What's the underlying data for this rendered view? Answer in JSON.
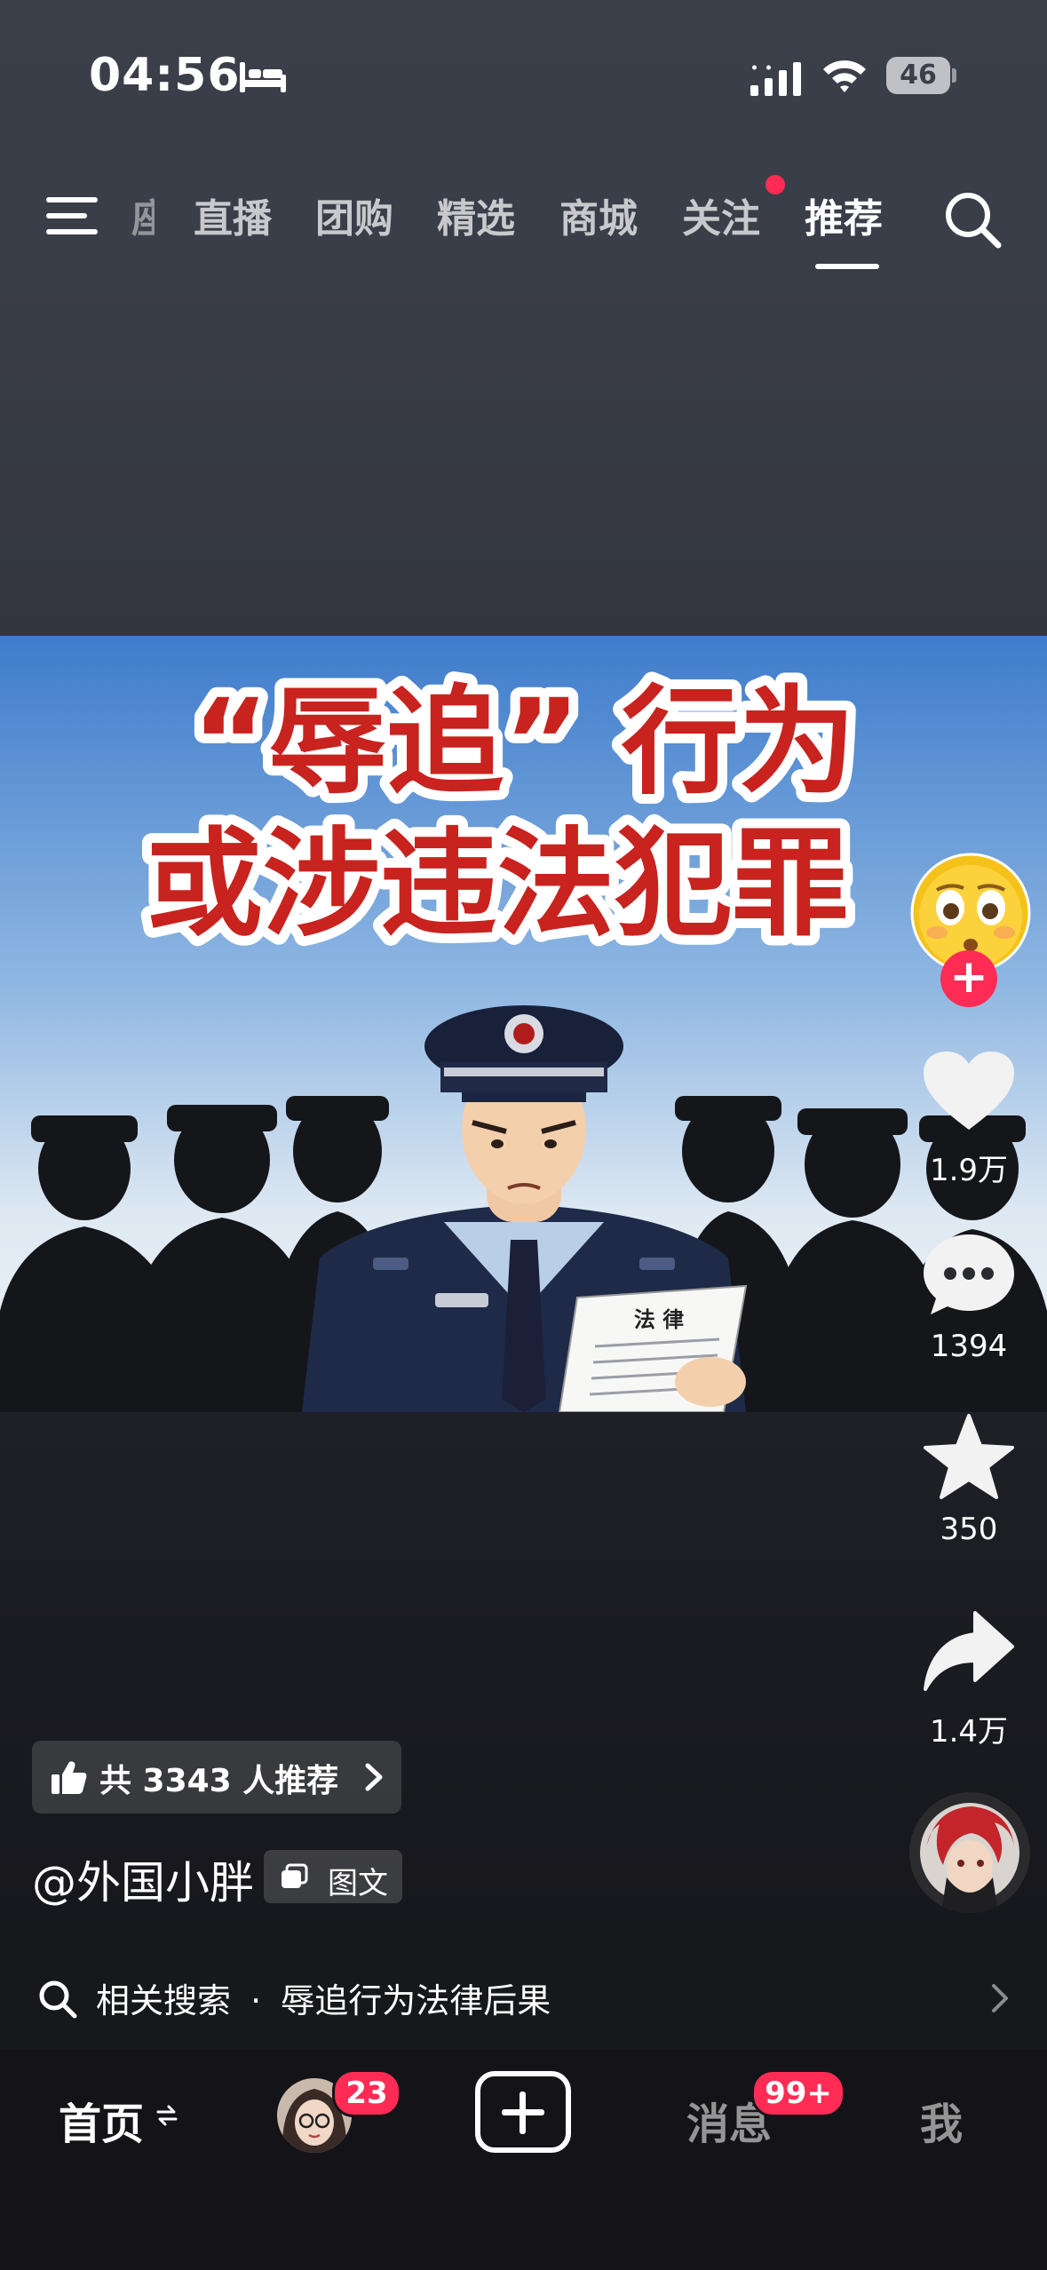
{
  "status_bar": {
    "time": "04:56",
    "battery": "46"
  },
  "top_nav": {
    "tabs": [
      {
        "label": "座",
        "state": "partial"
      },
      {
        "label": "直播"
      },
      {
        "label": "团购"
      },
      {
        "label": "精选"
      },
      {
        "label": "商城"
      },
      {
        "label": "关注",
        "has_dot": true
      },
      {
        "label": "推荐",
        "active": true
      }
    ]
  },
  "post": {
    "headline_line1": "“辱追” 行为",
    "headline_line2": "或涉违法犯罪",
    "document_title": "法 律",
    "author": "@外国小胖",
    "type_badge": "图文",
    "recommend_text": "共 3343 人推荐"
  },
  "actions": {
    "likes": "1.9万",
    "comments": "1394",
    "favorites": "350",
    "shares": "1.4万"
  },
  "related_search": {
    "prefix": "相关搜索",
    "separator": "·",
    "query": "辱追行为法律后果"
  },
  "bottom_tabs": {
    "home": "首页",
    "friends_badge": "23",
    "messages": "消息",
    "messages_badge": "99+",
    "me": "我"
  },
  "colors": {
    "accent": "#fe2c55",
    "headline_red": "#c8231e",
    "sky_top": "#3f7ccc",
    "uniform": "#1e2a48"
  },
  "icons": [
    "bed-icon",
    "signal-icon",
    "wifi-icon",
    "menu-icon",
    "search-icon",
    "heart-icon",
    "comment-icon",
    "star-icon",
    "share-icon",
    "thumb-up-icon",
    "chevron-right-icon",
    "pages-icon",
    "plus-icon",
    "swap-icon"
  ]
}
